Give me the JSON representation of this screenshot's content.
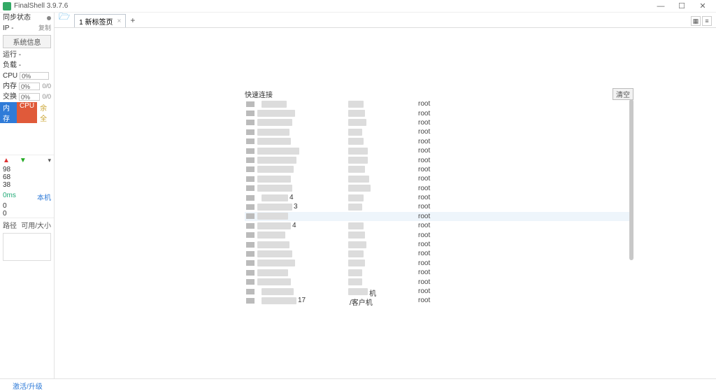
{
  "window": {
    "title": "FinalShell 3.9.7.6",
    "min": "—",
    "max": "☐",
    "close": "✕"
  },
  "sidebar": {
    "sync_label": "同步状态",
    "ip_label": "IP",
    "ip_value": "-",
    "copy": "复制",
    "sysinfo_btn": "系统信息",
    "run_label": "运行",
    "run_value": "-",
    "load_label": "负载",
    "load_value": "-",
    "cpu_label": "CPU",
    "cpu_pct": "0%",
    "mem_label": "内存",
    "mem_pct": "0%",
    "mem_ratio": "0/0",
    "swap_label": "交换",
    "swap_pct": "0%",
    "swap_ratio": "0/0",
    "tag_mem": "内存",
    "tag_cpu": "CPU",
    "tag_rem": "余全",
    "net_a": "98",
    "net_b": "68",
    "net_c": "38",
    "latency": "0ms",
    "host": "本机",
    "z1": "0",
    "z2": "0",
    "path_label": "路径",
    "size_label": "可用/大小"
  },
  "tabs": {
    "tab1": "1 新标签页",
    "grid_icon": "▦",
    "list_icon": "≡"
  },
  "panel": {
    "title": "快速连接",
    "clear": "清空"
  },
  "rows": [
    {
      "c1a": 6,
      "c1b": 36,
      "c2a": 0,
      "c2b": 22,
      "user": "root"
    },
    {
      "c1a": 0,
      "c1b": 54,
      "c2a": 0,
      "c2b": 24,
      "user": "root"
    },
    {
      "c1a": 0,
      "c1b": 50,
      "c2a": 0,
      "c2b": 26,
      "user": "root"
    },
    {
      "c1a": 0,
      "c1b": 46,
      "c2a": 0,
      "c2b": 20,
      "user": "root"
    },
    {
      "c1a": 0,
      "c1b": 48,
      "c2a": 0,
      "c2b": 22,
      "user": "root"
    },
    {
      "c1a": 0,
      "c1b": 60,
      "c2a": 0,
      "c2b": 28,
      "user": "root"
    },
    {
      "c1a": 0,
      "c1b": 56,
      "c2a": 0,
      "c2b": 28,
      "user": "root"
    },
    {
      "c1a": 0,
      "c1b": 52,
      "c2a": 0,
      "c2b": 24,
      "user": "root"
    },
    {
      "c1a": 0,
      "c1b": 48,
      "c2a": 0,
      "c2b": 30,
      "user": "root"
    },
    {
      "c1a": 0,
      "c1b": 50,
      "c2a": 0,
      "c2b": 32,
      "user": "root"
    },
    {
      "c1a": 6,
      "c1b": 38,
      "c2a": 0,
      "c2b": 22,
      "user": "root",
      "txt1": "4"
    },
    {
      "c1a": 0,
      "c1b": 50,
      "c2a": 0,
      "c2b": 20,
      "user": "root",
      "txt1": "3"
    },
    {
      "c1a": 0,
      "c1b": 44,
      "c2a": 0,
      "c2b": 0,
      "user": "root",
      "hover": true
    },
    {
      "c1a": 0,
      "c1b": 48,
      "c2a": 0,
      "c2b": 22,
      "user": "root",
      "txt1": "4"
    },
    {
      "c1a": 0,
      "c1b": 40,
      "c2a": 0,
      "c2b": 24,
      "user": "root"
    },
    {
      "c1a": 0,
      "c1b": 46,
      "c2a": 0,
      "c2b": 26,
      "user": "root"
    },
    {
      "c1a": 0,
      "c1b": 50,
      "c2a": 0,
      "c2b": 22,
      "user": "root"
    },
    {
      "c1a": 0,
      "c1b": 54,
      "c2a": 0,
      "c2b": 24,
      "user": "root"
    },
    {
      "c1a": 0,
      "c1b": 44,
      "c2a": 0,
      "c2b": 20,
      "user": "root"
    },
    {
      "c1a": 0,
      "c1b": 48,
      "c2a": 0,
      "c2b": 20,
      "user": "root"
    },
    {
      "c1a": 6,
      "c1b": 46,
      "c2a": 0,
      "c2b": 28,
      "user": "root",
      "txt2": "机"
    },
    {
      "c1a": 6,
      "c1b": 50,
      "c2a": 0,
      "c2b": 0,
      "user": "root",
      "txt1": "17",
      "txt2": "/客户机"
    }
  ],
  "footer": {
    "link": "激活/升级"
  }
}
